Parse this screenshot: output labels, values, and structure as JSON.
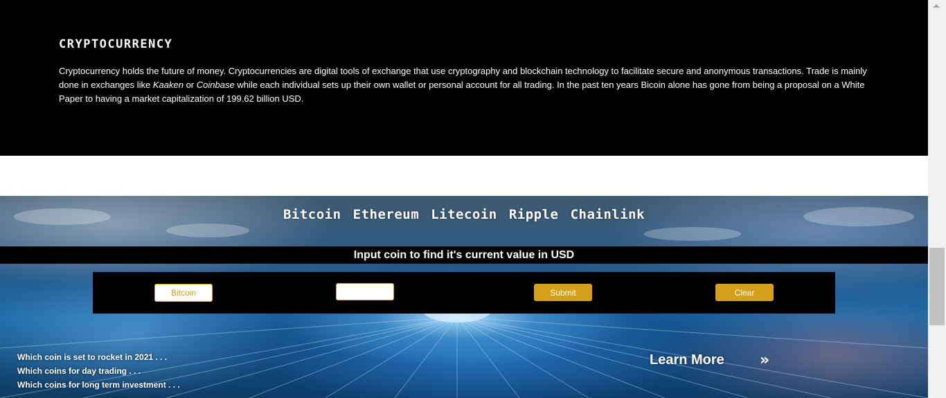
{
  "intro": {
    "title": "CRYPTOCURRENCY",
    "text_1": "Cryptocurrency holds the future of money. Cryptocurrencies are digital tools of exchange that use cryptography and blockchain technology to facilitate secure and anonymous transactions. Trade is mainly done in exchanges like ",
    "em_1": "Kaaken",
    "text_2": " or ",
    "em_2": "Coinbase",
    "text_3": " while each individual sets up their own wallet or personal account for all trading. In the past ten years Bicoin alone has gone from being a proposal on a White Paper to having a market capitalization of 199.62 billion USD."
  },
  "coin_nav": {
    "items": [
      "Bitcoin",
      "Ethereum",
      "Litecoin",
      "Ripple",
      "Chainlink"
    ]
  },
  "converter": {
    "prompt": "Input coin to find it's current value in USD",
    "coin_value": "Bitcoin",
    "amount_value": "",
    "submit_label": "Submit",
    "clear_label": "Clear"
  },
  "teasers": {
    "items": [
      "Which coin is set to rocket in 2021 . . .",
      "Which coins for day trading . . .",
      "Which coins for long term investment . . ."
    ]
  },
  "cta": {
    "learn_more": "Learn More",
    "chevrons": "»"
  },
  "colors": {
    "accent": "#d4a017",
    "dark": "#000000"
  }
}
